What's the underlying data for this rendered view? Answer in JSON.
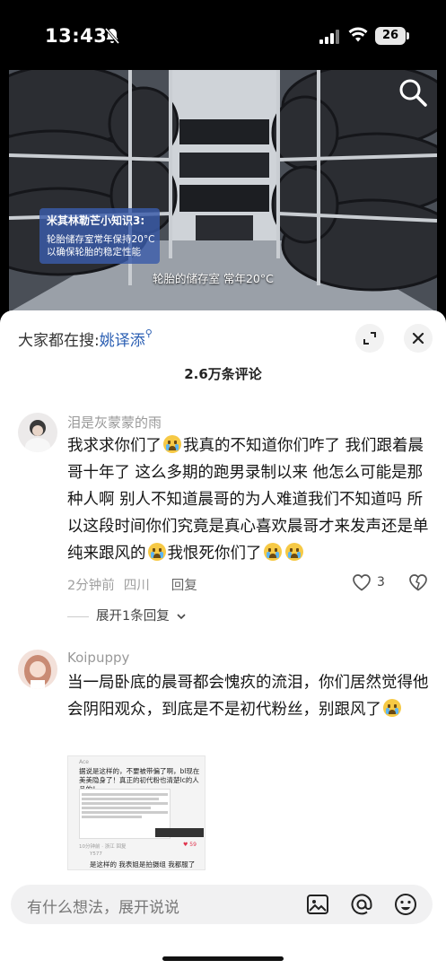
{
  "status_bar": {
    "time": "13:43",
    "battery": "26"
  },
  "video": {
    "tip_title": "米其林勒芒小知识3:",
    "tip_lines": [
      "轮胎储存室常年保持20°C",
      "以确保轮胎的稳定性能"
    ],
    "caption": "轮胎的储存室 常年20°C"
  },
  "header": {
    "search_prefix": "大家都在搜:",
    "search_keyword": "姚译添",
    "comment_count": "2.6万条评论"
  },
  "comments": [
    {
      "username": "泪是灰蒙蒙的雨",
      "text_parts": [
        "我求求你们了",
        "我真的不知道你们咋了 我们跟着晨哥十年了 这么多期的跑男录制以来 他怎么可能是那种人啊 别人不知道晨哥的为人难道我们不知道吗 所以这段时间你们究竟是真心喜欢晨哥才来发声还是单纯来跟风的",
        "我恨死你们了"
      ],
      "time": "2分钟前",
      "location": "四川",
      "reply_label": "回复",
      "likes": "3",
      "expand_label": "展开1条回复"
    },
    {
      "username": "Koipuppy",
      "text": "当一局卧底的晨哥都会愧疚的流泪，你们居然觉得他会阴阳观众，到底是不是初代粉丝，别跟风了",
      "embed": {
        "user": "Ace",
        "text": "据说是这样的，不要被带偏了啊，bl现在美美隐身了！真正的初代粉也清楚lc的人品的！",
        "meta": "10分钟前 · 浙江   回复",
        "likes": "59",
        "reply_user": "Y577",
        "reply_text": "是这样的 我表姐是拍摄组 我都服了"
      }
    }
  ],
  "input": {
    "placeholder": "有什么想法，展开说说"
  }
}
